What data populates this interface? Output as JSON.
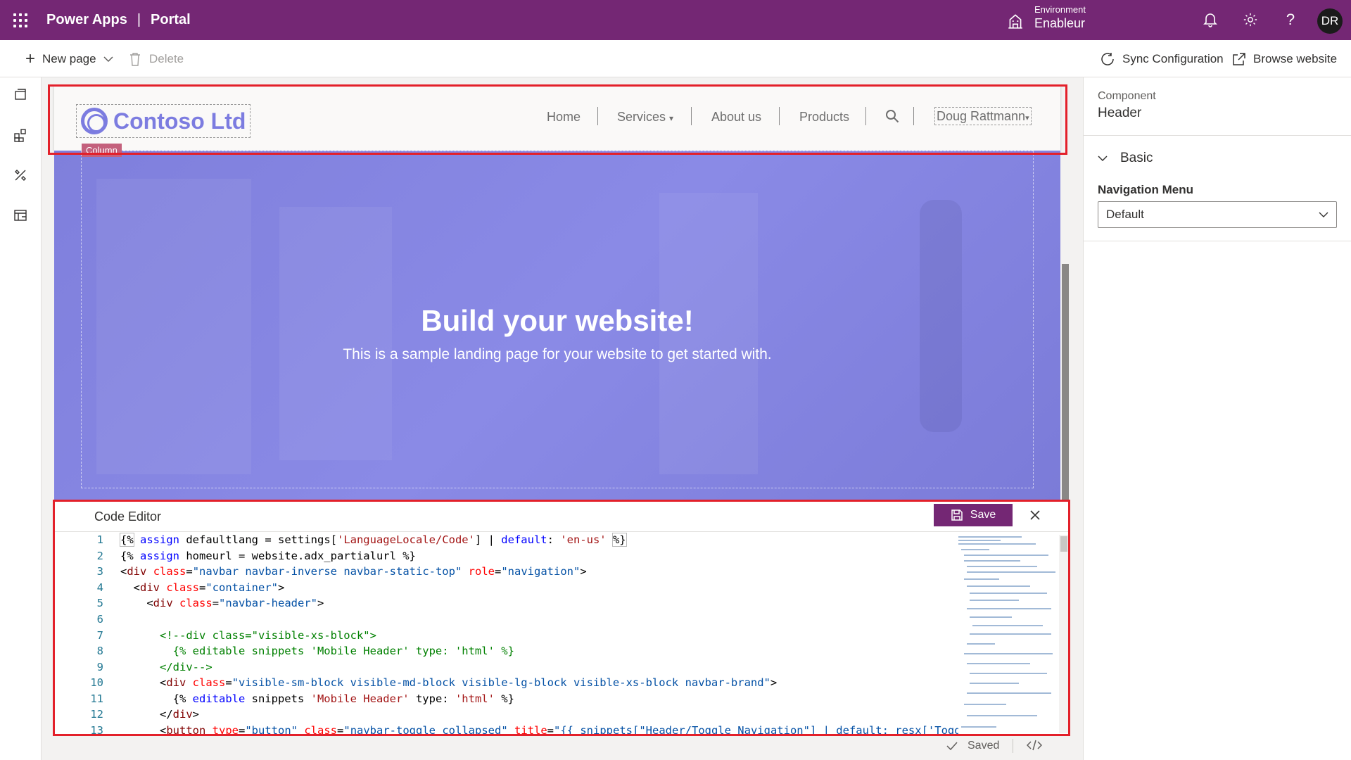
{
  "topbar": {
    "app_name": "Power Apps",
    "separator": "|",
    "portal": "Portal",
    "environment_label": "Environment",
    "environment_value": "Enableur",
    "user_initials": "DR"
  },
  "commandbar": {
    "new_page": "New page",
    "delete": "Delete",
    "sync": "Sync Configuration",
    "browse": "Browse website"
  },
  "site": {
    "logo_text": "Contoso Ltd",
    "column_tag": "Column",
    "nav": [
      "Home",
      "Services",
      "About us",
      "Products"
    ],
    "services_caret": "▾",
    "user": "Doug Rattmann",
    "hero_title": "Build your website!",
    "hero_subtitle": "This is a sample landing page for your website to get started with."
  },
  "editor": {
    "title": "Code Editor",
    "save_label": "Save",
    "line_numbers": [
      "1",
      "2",
      "3",
      "4",
      "5",
      "6",
      "7",
      "8",
      "9",
      "10",
      "11",
      "12",
      "13"
    ]
  },
  "status": {
    "saved": "Saved"
  },
  "panel": {
    "component_label": "Component",
    "component_value": "Header",
    "section": "Basic",
    "nav_menu_label": "Navigation Menu",
    "nav_menu_value": "Default"
  },
  "colors": {
    "brand": "#742774",
    "hero": "#8282e0",
    "highlight": "#e3202a"
  },
  "icons": [
    "waffle-icon",
    "environment-icon",
    "bell-icon",
    "gear-icon",
    "help-icon",
    "plus-icon",
    "chevron-down-icon",
    "trash-icon",
    "sync-icon",
    "external-link-icon",
    "pages-icon",
    "components-icon",
    "styles-icon",
    "data-icon",
    "search-icon",
    "save-icon",
    "close-icon",
    "check-icon",
    "code-icon"
  ]
}
